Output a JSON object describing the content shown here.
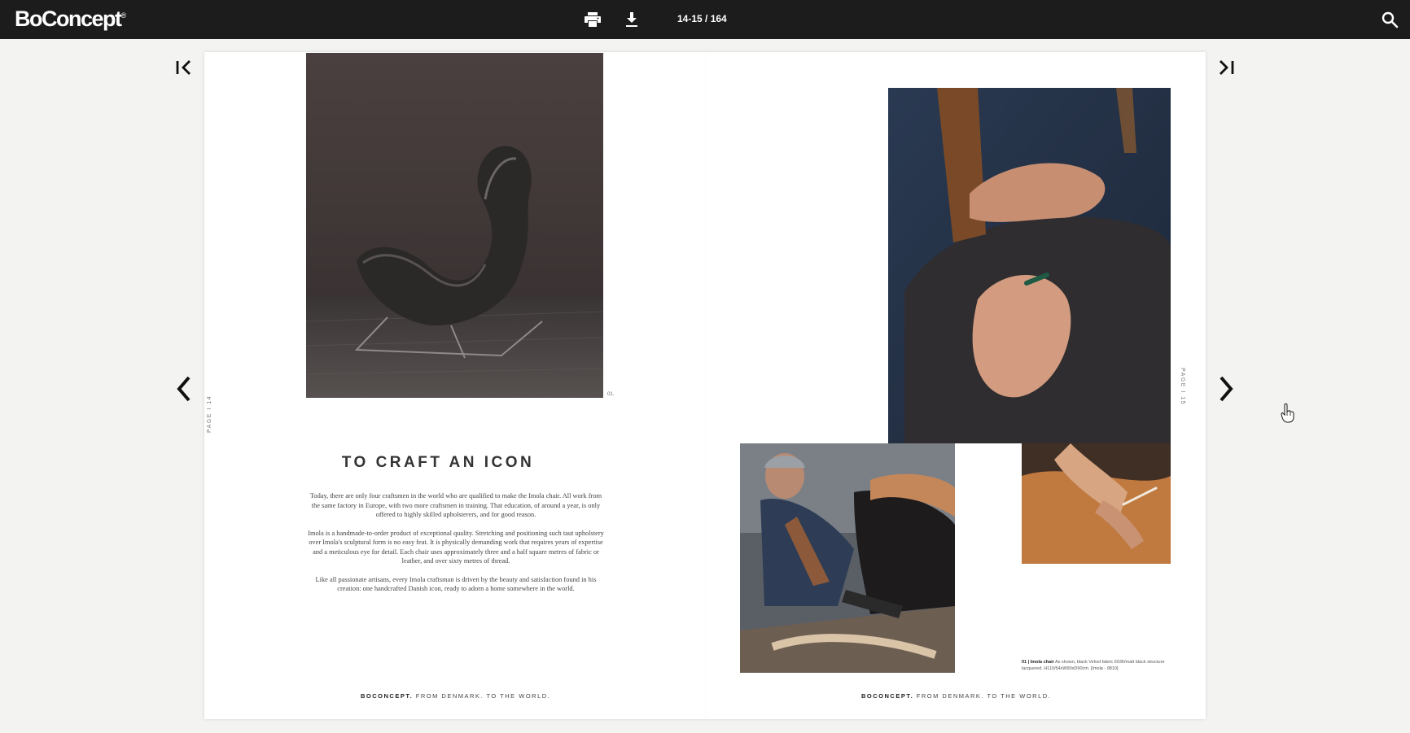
{
  "header": {
    "logo_text": "BoConcept",
    "logo_mark": "®",
    "page_counter": "14-15 / 164",
    "icons": [
      "print-icon",
      "download-icon",
      "search-icon"
    ]
  },
  "navigation": {
    "first_page_icon": "first-page-icon",
    "last_page_icon": "last-page-icon",
    "prev_icon": "chevron-left-icon",
    "next_icon": "chevron-right-icon"
  },
  "left_page": {
    "page_label": "PAGE  I  14",
    "photo_number": "01.",
    "title": "TO CRAFT AN ICON",
    "paragraphs": [
      "Today, there are only four craftsmen in the world who are qualified to make the Imola chair. All work from the same factory in Europe, with two more craftsmen in training. That education, of around a year, is only offered to highly skilled upholsterers, and for good reason.",
      "Imola is a handmade-to-order product of exceptional quality. Stretching and positioning such taut upholstery over Imola's sculptural form is no easy feat. It is physically demanding work that requires years of expertise and a meticulous eye for detail. Each chair uses approximately three and a half square metres of fabric or leather, and over sixty metres of thread.",
      "Like all passionate artisans, every Imola craftsman is driven by the beauty and satisfaction found in his creation: one handcrafted Danish icon, ready to adorn a home somewhere in the world."
    ],
    "footer_brand": "BOCONCEPT.",
    "footer_tagline": " FROM DENMARK. TO THE WORLD."
  },
  "right_page": {
    "page_label": "PAGE  I  15",
    "caption_bold": "01 | Imola chair",
    "caption_text": " As shown, black Velvet fabric 6036/matt black structure lacquered. H110/54xW90xD90cm. [Imola - 9810]",
    "footer_brand": "BOCONCEPT.",
    "footer_tagline": " FROM DENMARK. TO THE WORLD."
  },
  "colors": {
    "topbar": "#1c1c1c",
    "background": "#f3f3f1",
    "page": "#ffffff"
  }
}
